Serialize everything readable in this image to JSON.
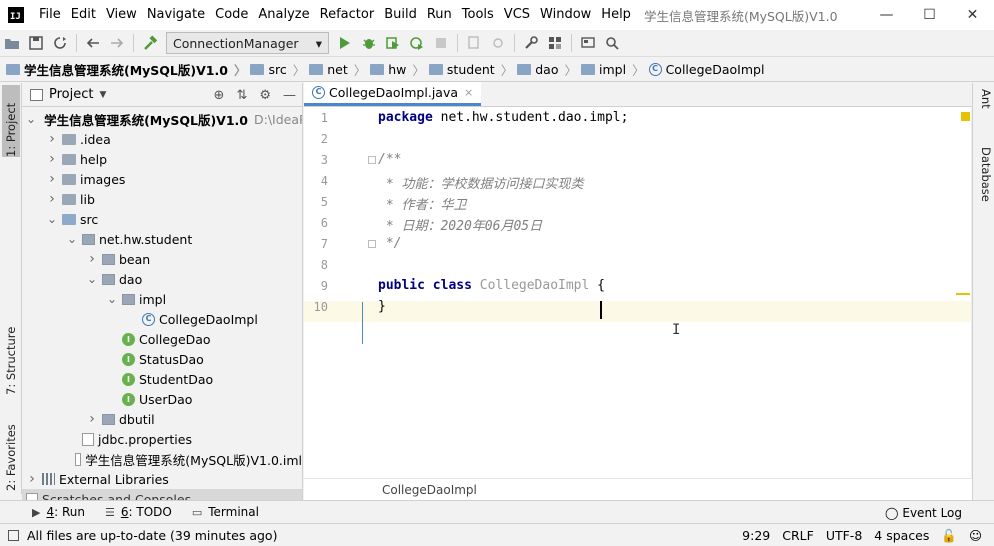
{
  "titlebar": {
    "logo": "IJ",
    "menu": [
      "File",
      "Edit",
      "View",
      "Navigate",
      "Code",
      "Analyze",
      "Refactor",
      "Build",
      "Run",
      "Tools",
      "VCS",
      "Window",
      "Help"
    ],
    "window_title": "学生信息管理系统(MySQL版)V1.0",
    "controls": {
      "minimize": "—",
      "maximize": "☐",
      "close": "✕"
    }
  },
  "toolbar": {
    "run_config": "ConnectionManager",
    "run_config_caret": "▾"
  },
  "breadcrumb": [
    "学生信息管理系统(MySQL版)V1.0",
    "src",
    "net",
    "hw",
    "student",
    "dao",
    "impl",
    "CollegeDaoImpl"
  ],
  "left_strip": {
    "project_tab": "1: Project",
    "structure_tab": "7: Structure",
    "favorites_tab": "2: Favorites"
  },
  "right_strip": {
    "ant_tab": "Ant",
    "database_tab": "Database"
  },
  "project_panel": {
    "title": "Project",
    "tree": [
      {
        "label": "学生信息管理系统(MySQL版)V1.0",
        "path": "D:\\IdeaP",
        "depth": 0,
        "type": "root",
        "expanded": true
      },
      {
        "label": ".idea",
        "depth": 1,
        "type": "folder",
        "expanded": false
      },
      {
        "label": "help",
        "depth": 1,
        "type": "folder",
        "expanded": false
      },
      {
        "label": "images",
        "depth": 1,
        "type": "folder",
        "expanded": false
      },
      {
        "label": "lib",
        "depth": 1,
        "type": "folder",
        "expanded": false
      },
      {
        "label": "src",
        "depth": 1,
        "type": "src",
        "expanded": true
      },
      {
        "label": "net.hw.student",
        "depth": 2,
        "type": "package",
        "expanded": true
      },
      {
        "label": "bean",
        "depth": 3,
        "type": "package",
        "expanded": false
      },
      {
        "label": "dao",
        "depth": 3,
        "type": "package",
        "expanded": true
      },
      {
        "label": "impl",
        "depth": 4,
        "type": "package",
        "expanded": true
      },
      {
        "label": "CollegeDaoImpl",
        "depth": 5,
        "type": "class"
      },
      {
        "label": "CollegeDao",
        "depth": 4,
        "type": "interface"
      },
      {
        "label": "StatusDao",
        "depth": 4,
        "type": "interface"
      },
      {
        "label": "StudentDao",
        "depth": 4,
        "type": "interface"
      },
      {
        "label": "UserDao",
        "depth": 4,
        "type": "interface"
      },
      {
        "label": "dbutil",
        "depth": 3,
        "type": "package",
        "expanded": false
      },
      {
        "label": "jdbc.properties",
        "depth": 2,
        "type": "file"
      },
      {
        "label": "学生信息管理系统(MySQL版)V1.0.iml",
        "depth": 2,
        "type": "file"
      },
      {
        "label": "External Libraries",
        "depth": 0,
        "type": "lib",
        "expanded": false
      },
      {
        "label": "Scratches and Consoles",
        "depth": 0,
        "type": "scratches"
      }
    ]
  },
  "editor": {
    "tab_label": "CollegeDaoImpl.java",
    "tab_close": "×",
    "lines": [
      {
        "n": "1",
        "parts": [
          {
            "t": "package",
            "c": "kw"
          },
          {
            "t": " net.hw.student.dao.impl;",
            "c": ""
          }
        ]
      },
      {
        "n": "2",
        "parts": []
      },
      {
        "n": "3",
        "parts": [
          {
            "t": "/**",
            "c": "cm"
          }
        ]
      },
      {
        "n": "4",
        "parts": [
          {
            "t": " * 功能：学校数据访问接口实现类",
            "c": "cm"
          }
        ]
      },
      {
        "n": "5",
        "parts": [
          {
            "t": " * 作者：华卫",
            "c": "cm"
          }
        ]
      },
      {
        "n": "6",
        "parts": [
          {
            "t": " * 日期：2020年06月05日",
            "c": "cm"
          }
        ]
      },
      {
        "n": "7",
        "parts": [
          {
            "t": " */",
            "c": "cm"
          }
        ]
      },
      {
        "n": "8",
        "parts": []
      },
      {
        "n": "9",
        "parts": [
          {
            "t": "public",
            "c": "kw"
          },
          {
            "t": " ",
            "c": ""
          },
          {
            "t": "class",
            "c": "kw"
          },
          {
            "t": " ",
            "c": ""
          },
          {
            "t": "CollegeDaoImpl",
            "c": "cls"
          },
          {
            "t": " {",
            "c": ""
          }
        ]
      },
      {
        "n": "10",
        "parts": [
          {
            "t": "}",
            "c": ""
          }
        ]
      }
    ],
    "bottom_breadcrumb": "CollegeDaoImpl"
  },
  "bottom_tools": {
    "run": {
      "num": "4",
      "label": ": Run"
    },
    "todo": {
      "num": "6",
      "label": ": TODO"
    },
    "terminal": "Terminal",
    "event_log": "Event Log"
  },
  "status": {
    "message": "All files are up-to-date (39 minutes ago)",
    "position": "9:29",
    "line_sep": "CRLF",
    "encoding": "UTF-8",
    "indent": "4 spaces"
  },
  "colors": {
    "keyword": "#000080",
    "comment": "#808080",
    "interface_icon": "#69b04e",
    "class_icon": "#3b77b5",
    "current_line": "#fcfae6",
    "tab_underline": "#4a88c7"
  }
}
